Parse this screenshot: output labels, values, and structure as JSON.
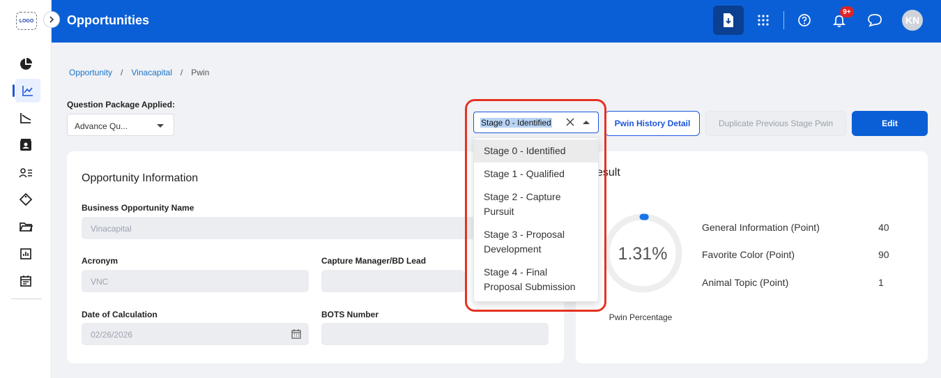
{
  "app": {
    "logo_text": "LOGO",
    "page_title": "Opportunities",
    "notification_badge": "9+",
    "avatar_initials": "KN"
  },
  "breadcrumb": {
    "items": [
      "Opportunity",
      "Vinacapital",
      "Pwin"
    ],
    "separator": "/"
  },
  "question_package": {
    "label": "Question Package Applied:",
    "value": "Advance Qu..."
  },
  "stage_select": {
    "value": "Stage 0 - Identified",
    "options": [
      "Stage 0 - Identified",
      "Stage 1 - Qualified",
      "Stage 2 - Capture Pursuit",
      "Stage 3 - Proposal Development",
      "Stage 4 - Final Proposal Submission"
    ]
  },
  "actions": {
    "pwin_history": "Pwin History Detail",
    "duplicate": "Duplicate Previous Stage Pwin",
    "edit": "Edit"
  },
  "opportunity_info": {
    "title": "Opportunity Information",
    "business_name_label": "Business Opportunity Name",
    "business_name_value": "Vinacapital",
    "acronym_label": "Acronym",
    "acronym_value": "VNC",
    "capture_manager_label": "Capture Manager/BD Lead",
    "capture_manager_value": "",
    "date_label": "Date of Calculation",
    "date_value": "02/26/2026",
    "bots_label": "BOTS Number",
    "bots_value": ""
  },
  "result": {
    "title_partial": "esult",
    "percentage": "1.31%",
    "percentage_fraction": 0.0131,
    "percentage_label": "Pwin Percentage",
    "rows": [
      {
        "label": "General Information (Point)",
        "value": "40"
      },
      {
        "label": "Favorite Color (Point)",
        "value": "90"
      },
      {
        "label": "Animal Topic (Point)",
        "value": "1"
      }
    ]
  },
  "colors": {
    "primary": "#0b5fd6",
    "highlight": "#e53222",
    "badge": "#e02424"
  }
}
